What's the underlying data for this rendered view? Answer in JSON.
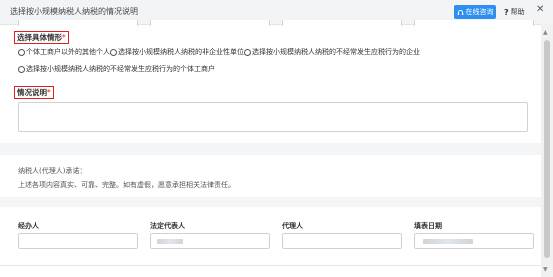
{
  "header": {
    "title": "选择按小规模纳税人纳税的情况说明",
    "online_consult": "在线咨询",
    "help_q": "?",
    "help": "帮助",
    "close": "✕"
  },
  "situation": {
    "label": "选择具体情形",
    "required_mark": "*",
    "options": [
      "个体工商户以外的其他个人",
      "选择按小规模纳税人纳税的非企业性单位",
      "选择按小规模纳税人纳税的不经常发生应税行为的企业",
      "选择按小规模纳税人纳税的不经常发生应税行为的个体工商户"
    ]
  },
  "explanation": {
    "label": "情况说明",
    "required_mark": "*",
    "value": ""
  },
  "pledge": {
    "line1": "纳税人(代理人)承诺：",
    "line2": "上述各项内容真实、可靠、完整。如有虚假，愿意承担相关法律责任。"
  },
  "signatures": {
    "handler": {
      "label": "经办人",
      "value": ""
    },
    "legal_rep": {
      "label": "法定代表人",
      "value": ""
    },
    "agent": {
      "label": "代理人",
      "value": ""
    },
    "fill_date": {
      "label": "填表日期",
      "value": ""
    }
  },
  "colors": {
    "accent": "#2f8ff0",
    "required": "#e02020",
    "section_gap": "#f4f5f7"
  }
}
